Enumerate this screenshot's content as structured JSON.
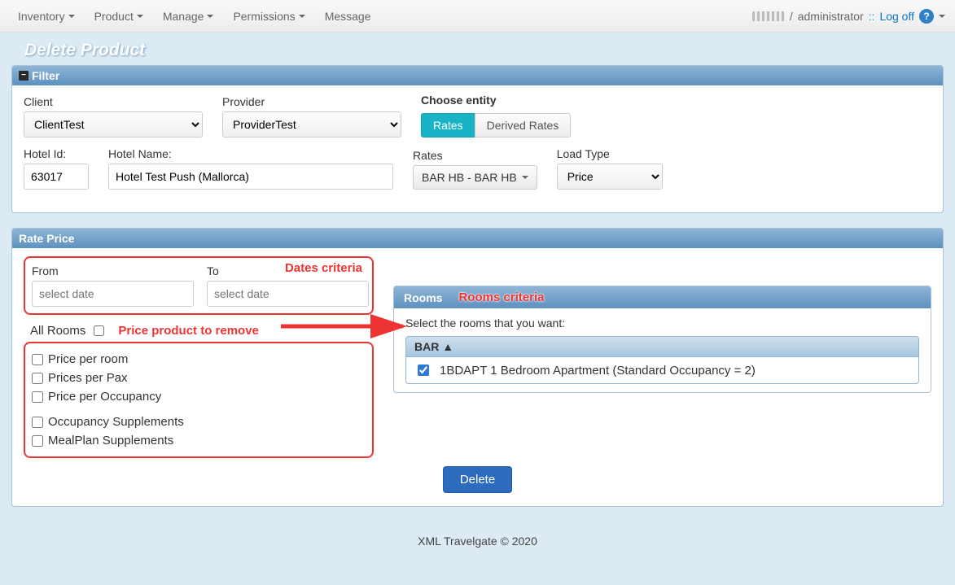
{
  "nav": {
    "items": [
      "Inventory",
      "Product",
      "Manage",
      "Permissions",
      "Message"
    ],
    "role": "administrator",
    "logoff": "Log off"
  },
  "page": {
    "title": "Delete Product"
  },
  "filter": {
    "title": "Filter",
    "client_label": "Client",
    "client_value": "ClientTest",
    "provider_label": "Provider",
    "provider_value": "ProviderTest",
    "choose_entity_label": "Choose entity",
    "entity_rates": "Rates",
    "entity_derived": "Derived Rates",
    "hotel_id_label": "Hotel Id:",
    "hotel_id_value": "63017",
    "hotel_name_label": "Hotel Name:",
    "hotel_name_value": "Hotel Test Push (Mallorca)",
    "rates_label": "Rates",
    "rates_value": "BAR HB - BAR HB",
    "load_type_label": "Load Type",
    "load_type_value": "Price"
  },
  "rate_price": {
    "title": "Rate Price",
    "from_label": "From",
    "to_label": "To",
    "date_placeholder": "select date",
    "all_rooms_label": "All Rooms",
    "options": {
      "price_per_room": "Price per room",
      "prices_per_pax": "Prices per Pax",
      "price_per_occupancy": "Price per Occupancy",
      "occupancy_supplements": "Occupancy Supplements",
      "mealplan_supplements": "MealPlan Supplements"
    },
    "annotations": {
      "dates": "Dates criteria",
      "price_product": "Price product to remove",
      "rooms": "Rooms criteria"
    },
    "rooms_title": "Rooms",
    "rooms_instruction": "Select the rooms that you want:",
    "rooms_category": "BAR ▲",
    "room_item": "1BDAPT 1 Bedroom Apartment (Standard Occupancy = 2)",
    "delete_label": "Delete"
  },
  "footer": "XML Travelgate © 2020"
}
